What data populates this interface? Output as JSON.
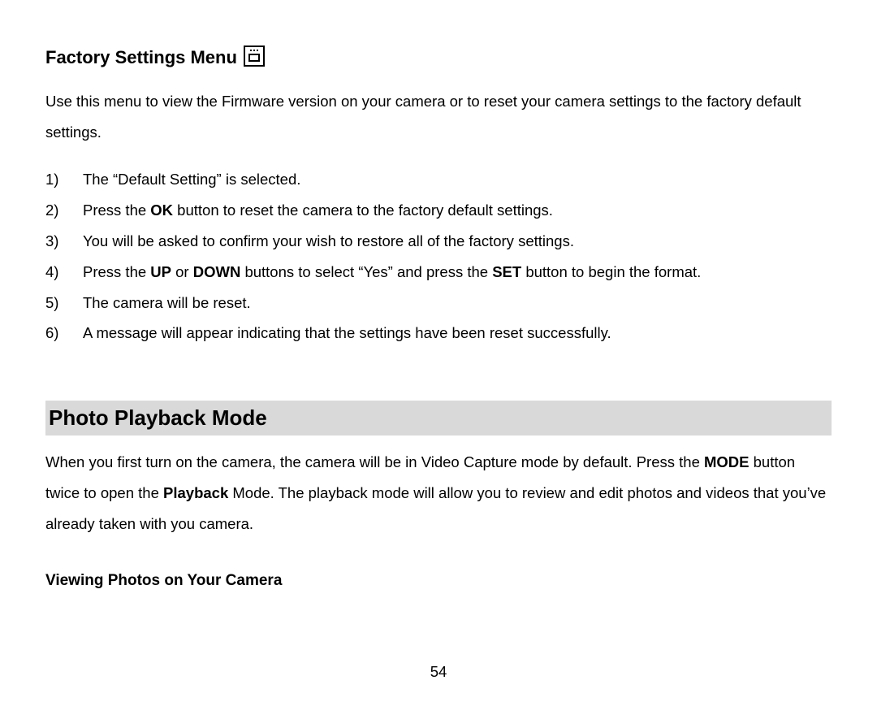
{
  "section1": {
    "heading": "Factory Settings Menu",
    "iconName": "settings-box-icon",
    "intro": "Use this menu to view the Firmware version on your camera or to reset your camera settings to the factory default settings.",
    "steps": {
      "s1": "The “Default Setting” is selected.",
      "s2a": "Press the ",
      "s2b": "OK",
      "s2c": " button to reset the camera to the factory default settings.",
      "s3": "You will be asked to confirm your wish to restore all of the factory settings.",
      "s4a": "Press the ",
      "s4b": "UP",
      "s4c": " or ",
      "s4d": "DOWN",
      "s4e": " buttons to select “Yes” and press the ",
      "s4f": "SET",
      "s4g": " button to begin the format.",
      "s5": "The camera will be reset.",
      "s6": "A message will appear indicating that the settings have been reset successfully."
    }
  },
  "section2": {
    "heading": "Photo Playback Mode",
    "p1a": "When you first turn on the camera, the camera will be in Video Capture mode by default. Press the ",
    "p1b": "MODE",
    "p1c": " button twice to open the ",
    "p1d": "Playback",
    "p1e": " Mode. The playback mode will allow you to review and edit photos and videos that you’ve already taken with you camera.",
    "subheading": "Viewing Photos on Your Camera"
  },
  "pageNumber": "54"
}
